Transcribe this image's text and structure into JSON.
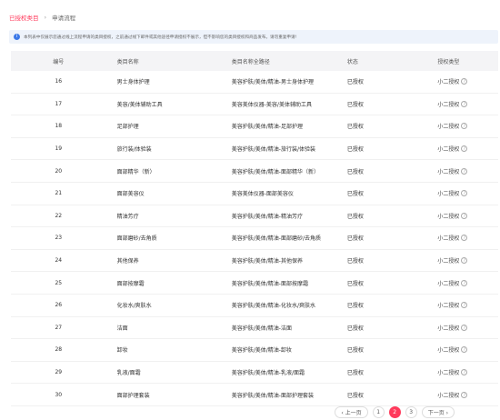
{
  "breadcrumb": {
    "current": "已授权类目",
    "separator": "›",
    "next": "申请流程"
  },
  "notice": {
    "icon": "info-icon",
    "text": "本列表中仅展示您通过线上流程申请的类目授权，之前通过线下邮件或其他途径申请授权不展示，但不影响您的类目授权和商品发布。请勿重复申请!"
  },
  "table": {
    "headers": [
      "编号",
      "类目名称",
      "类目名称全路径",
      "状态",
      "授权类型"
    ],
    "rows": [
      {
        "id": "16",
        "name": "男士身体护理",
        "path": "美容护肤/美体/精油-男士身体护理",
        "status": "已授权",
        "type": "小二授权"
      },
      {
        "id": "17",
        "name": "美容/美体辅助工具",
        "path": "美容美体仪器-美容/美体辅助工具",
        "status": "已授权",
        "type": "小二授权"
      },
      {
        "id": "18",
        "name": "足部护理",
        "path": "美容护肤/美体/精油-足部护理",
        "status": "已授权",
        "type": "小二授权"
      },
      {
        "id": "19",
        "name": "旅行装/体验装",
        "path": "美容护肤/美体/精油-旅行装/体验装",
        "status": "已授权",
        "type": "小二授权"
      },
      {
        "id": "20",
        "name": "面部精华（新）",
        "path": "美容护肤/美体/精油-面部精华（新）",
        "status": "已授权",
        "type": "小二授权"
      },
      {
        "id": "21",
        "name": "面部美容仪",
        "path": "美容美体仪器-面部美容仪",
        "status": "已授权",
        "type": "小二授权"
      },
      {
        "id": "22",
        "name": "精油芳疗",
        "path": "美容护肤/美体/精油-精油芳疗",
        "status": "已授权",
        "type": "小二授权"
      },
      {
        "id": "23",
        "name": "面部磨砂/去角质",
        "path": "美容护肤/美体/精油-面部磨砂/去角质",
        "status": "已授权",
        "type": "小二授权"
      },
      {
        "id": "24",
        "name": "其他保养",
        "path": "美容护肤/美体/精油-其他保养",
        "status": "已授权",
        "type": "小二授权"
      },
      {
        "id": "25",
        "name": "面部按摩霜",
        "path": "美容护肤/美体/精油-面部按摩霜",
        "status": "已授权",
        "type": "小二授权"
      },
      {
        "id": "26",
        "name": "化妆水/爽肤水",
        "path": "美容护肤/美体/精油-化妆水/爽肤水",
        "status": "已授权",
        "type": "小二授权"
      },
      {
        "id": "27",
        "name": "洁面",
        "path": "美容护肤/美体/精油-洁面",
        "status": "已授权",
        "type": "小二授权"
      },
      {
        "id": "28",
        "name": "卸妆",
        "path": "美容护肤/美体/精油-卸妆",
        "status": "已授权",
        "type": "小二授权"
      },
      {
        "id": "29",
        "name": "乳液/面霜",
        "path": "美容护肤/美体/精油-乳液/面霜",
        "status": "已授权",
        "type": "小二授权"
      },
      {
        "id": "30",
        "name": "面部护理套装",
        "path": "美容护肤/美体/精油-面部护理套装",
        "status": "已授权",
        "type": "小二授权"
      }
    ]
  },
  "pagination": {
    "prev": "‹ 上一页",
    "pages": [
      "1",
      "2",
      "3"
    ],
    "active": "2",
    "next": "下一页 ›"
  },
  "colors": {
    "accent": "#ff3b5c",
    "info": "#3b78e7"
  }
}
